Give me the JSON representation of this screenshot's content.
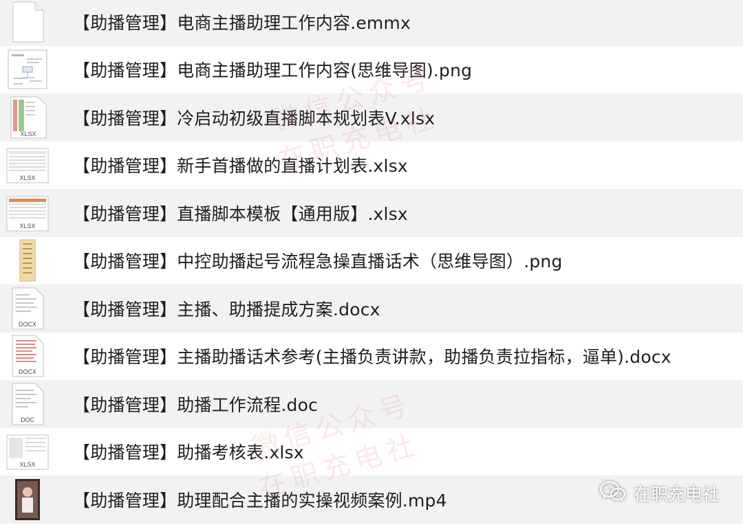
{
  "files": [
    {
      "name": "【助播管理】电商主播助理工作内容.emmx",
      "icon": "blank-document-icon"
    },
    {
      "name": "【助播管理】电商主播助理工作内容(思维导图).png",
      "icon": "png-image-icon"
    },
    {
      "name": "【助播管理】冷启动初级直播脚本规划表V.xlsx",
      "icon": "xlsx-icon",
      "badge": "XLSX"
    },
    {
      "name": "【助播管理】新手首播做的直播计划表.xlsx",
      "icon": "xlsx-icon",
      "badge": "XLSX"
    },
    {
      "name": "【助播管理】直播脚本模板【通用版】.xlsx",
      "icon": "xlsx-icon",
      "badge": "XLSX"
    },
    {
      "name": "【助播管理】中控助播起号流程急操直播话术（思维导图）.png",
      "icon": "png-image-icon"
    },
    {
      "name": "【助播管理】主播、助播提成方案.docx",
      "icon": "docx-icon",
      "badge": "DOCX"
    },
    {
      "name": "【助播管理】主播助播话术参考(主播负责讲款，助播负责拉指标，逼单).docx",
      "icon": "docx-icon",
      "badge": "DOCX"
    },
    {
      "name": "【助播管理】助播工作流程.doc",
      "icon": "doc-icon",
      "badge": "DOC"
    },
    {
      "name": "【助播管理】助播考核表.xlsx",
      "icon": "xlsx-icon",
      "badge": "XLSX"
    },
    {
      "name": "【助播管理】助理配合主播的实操视频案例.mp4",
      "icon": "video-thumbnail-icon"
    }
  ],
  "watermarks": [
    "微信公众号",
    "在职充电社",
    "微信公众号",
    "在职充电社"
  ],
  "brand": {
    "text": "在职充电社",
    "icon": "wechat-icon"
  },
  "colors": {
    "row_alt": "#f2f2f2",
    "text": "#1e1e1e",
    "watermark": "#e67878"
  }
}
